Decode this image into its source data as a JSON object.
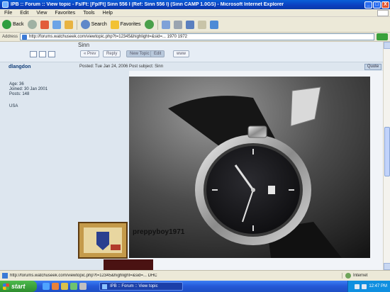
{
  "window": {
    "title": "IPB :: Forum :: View topic - Fs/Ft: [Fp/Ft] Sinn 556 I (Ref: Sinn 556 I) (Sinn CAMP 1.0GS) - Microsoft Internet Explorer",
    "minimize": "_",
    "maximize": "□",
    "close": "X"
  },
  "menu": [
    "File",
    "Edit",
    "View",
    "Favorites",
    "Tools",
    "Help"
  ],
  "toolbar": {
    "back": "Back",
    "search": "Search",
    "favorites": "Favorites"
  },
  "address": {
    "label": "Address",
    "url": "http://forums.watchuseek.com/viewtopic.php?t=12345&highlight=&sid=... 1970 1972"
  },
  "topic": {
    "heading": "Sinn",
    "buttons": [
      "« Prev",
      "Reply",
      "New Topic",
      "Edit",
      "www"
    ]
  },
  "post": {
    "username": "dlangdon",
    "posted": "Posted: Tue Jan 24, 2006    Post subject: Sinn",
    "quote": "Quote",
    "user_info": [
      "Age: 36",
      "Joined: 30 Jan 2001",
      "Posts: 148"
    ],
    "location": "USA",
    "signature": "preppyboy1971"
  },
  "status": {
    "text": "http://forums.watchuseek.com/viewtopic.php?t=12345&highlight=&sid=... DHC",
    "zone": "Internet"
  },
  "taskbar": {
    "start": "start",
    "active_window": "IPB :: Forum :: View topic",
    "clock": "12:47 PM"
  },
  "colors": {
    "title_bar": "#0b3fbf",
    "post_header": "#dde6ef",
    "start_button": "#2e8d2e"
  }
}
